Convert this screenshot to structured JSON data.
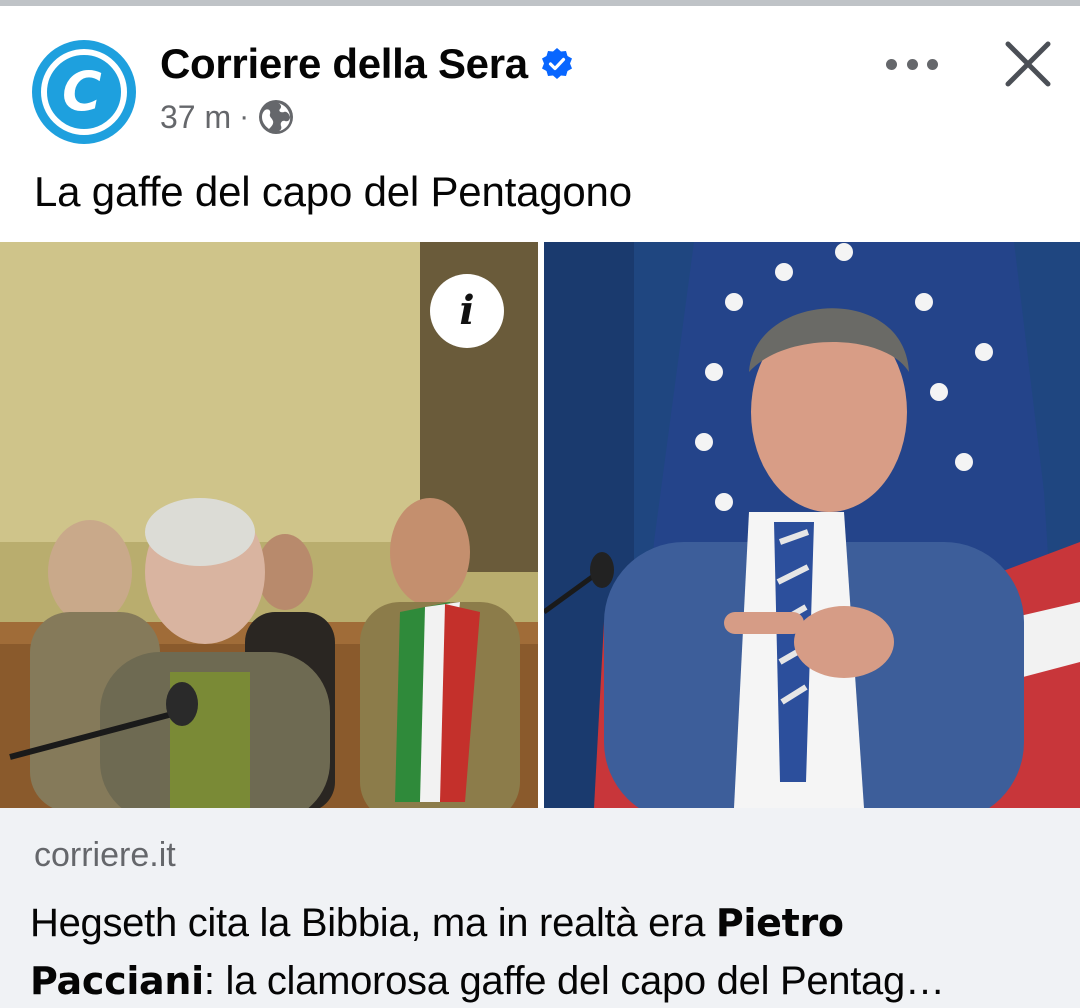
{
  "post": {
    "page_name": "Corriere della Sera",
    "avatar_letter": "C",
    "time": "37 m",
    "separator": "·",
    "text": "La gaffe del capo del Pentagono",
    "info_letter": "i"
  },
  "link": {
    "domain": "corriere.it",
    "title_part1": "Hegseth cita la Bibbia, ma in realtà era ",
    "title_name1": "Pietro",
    "title_name2": "Pacciani",
    "title_part2": ": la clamorosa gaffe del capo del Pentag…"
  },
  "colors": {
    "avatar_blue": "#1ea0de",
    "verified_blue": "#0866ff",
    "meta_gray": "#65676b",
    "card_bg": "#f0f2f5"
  },
  "icons": {
    "verified": "verified-badge-icon",
    "globe": "globe-icon",
    "more": "more-options-icon",
    "close": "close-icon",
    "info": "info-icon"
  }
}
